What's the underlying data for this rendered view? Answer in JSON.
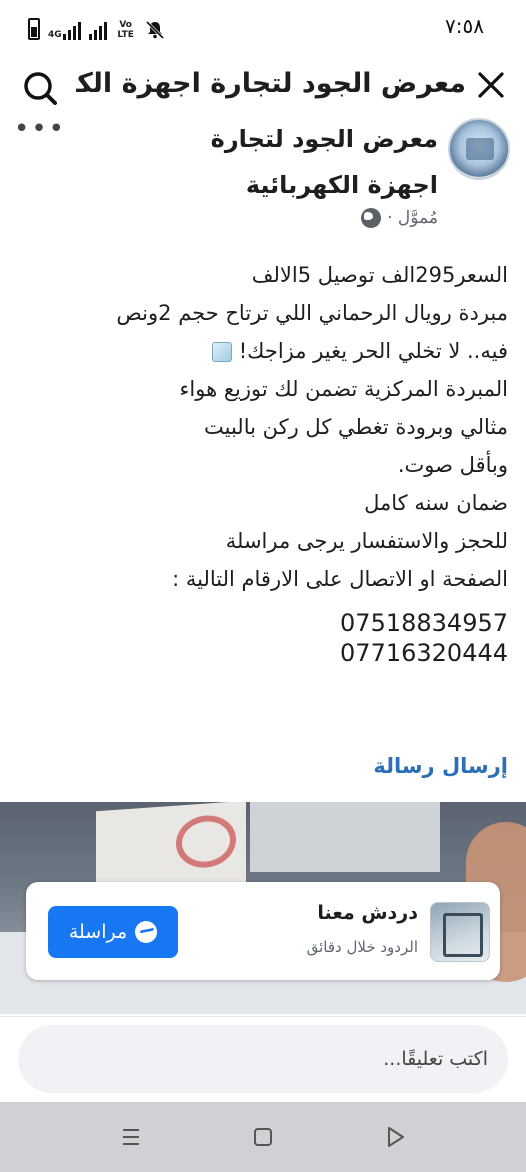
{
  "status_bar": {
    "time": "٧:٥٨",
    "network": "4G",
    "volte": "Vo LTE"
  },
  "header": {
    "title": "معرض الجود لتجارة اجهزة الكهربائ..."
  },
  "post": {
    "page_name": "معرض الجود لتجارة اجهزة الكهربائية",
    "sponsored_label": "مُموَّل ·",
    "lines": [
      "السعر295الف توصيل 5الالف",
      "مبردة رويال الرحماني اللي ترتاح حجم 2ونص",
      "فيه.. لا تخلي الحر يغير مزاجك!",
      "المبردة المركزية تضمن لك توزيع هواء",
      "مثالي وبرودة تغطي كل ركن بالبيت",
      "وبأقل صوت.",
      "ضمان سنه كامل",
      "للحجز والاستفسار يرجى مراسلة",
      "الصفحة او الاتصال على الارقام التالية :"
    ],
    "phones": [
      "07518834957",
      "07716320444"
    ],
    "send_message_link": "إرسال رسالة"
  },
  "cta": {
    "title": "دردش معنا",
    "subtitle": "الردود خلال دقائق",
    "button_label": "مراسلة"
  },
  "comment": {
    "placeholder": "اكتب تعليقًا..."
  }
}
